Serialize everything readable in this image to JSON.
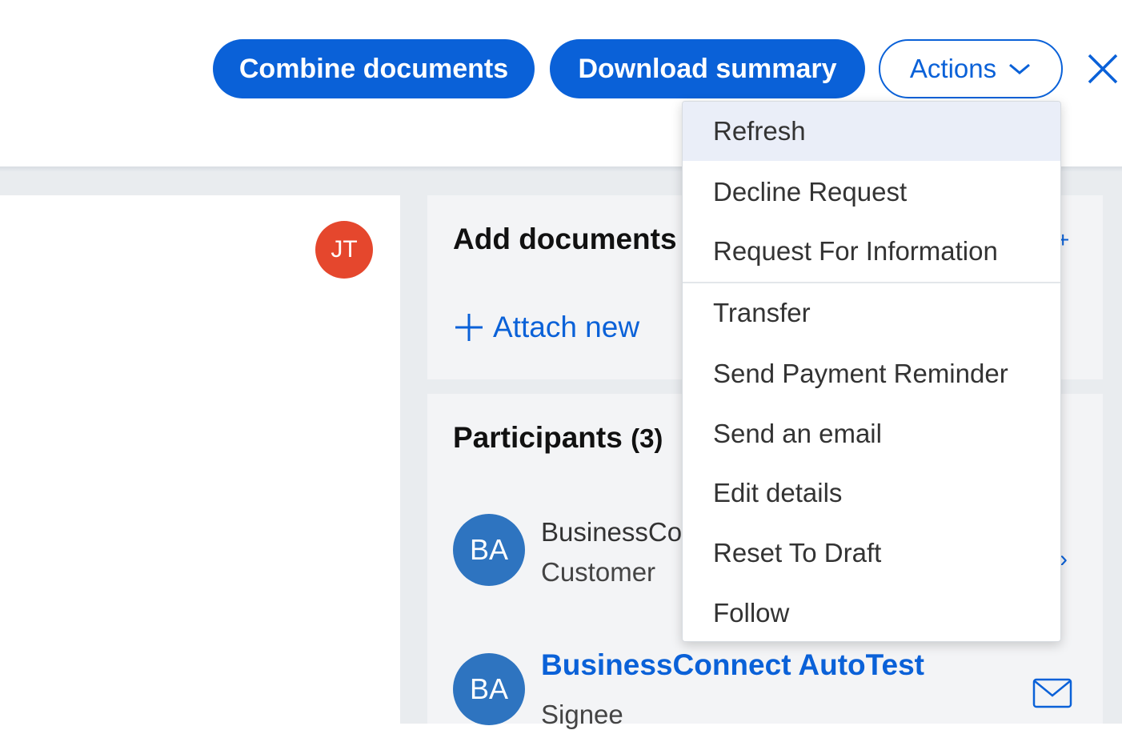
{
  "header": {
    "combine_label": "Combine documents",
    "download_label": "Download summary",
    "actions_label": "Actions"
  },
  "actions_menu": {
    "items": [
      {
        "label": "Refresh",
        "highlighted": true
      },
      {
        "label": "Decline Request"
      },
      {
        "label": "Request For Information"
      },
      {
        "label": "Transfer"
      },
      {
        "label": "Send Payment Reminder"
      },
      {
        "label": "Send an email"
      },
      {
        "label": "Edit details"
      },
      {
        "label": "Reset To Draft"
      },
      {
        "label": "Follow"
      }
    ]
  },
  "left_panel": {
    "avatar_initials": "JT"
  },
  "documents_card": {
    "title": "Add documents",
    "attach_label": "Attach new"
  },
  "participants_card": {
    "title": "Participants",
    "count": "(3)",
    "participants": [
      {
        "initials": "BA",
        "name": "BusinessCo",
        "role": "Customer"
      },
      {
        "initials": "BA",
        "name": "BusinessConnect AutoTest",
        "role": "Signee"
      }
    ]
  },
  "colors": {
    "primary": "#0a61d8",
    "avatar_jt": "#e5472d",
    "avatar_ba": "#2e74c0",
    "menu_hover": "#eaeef8"
  }
}
